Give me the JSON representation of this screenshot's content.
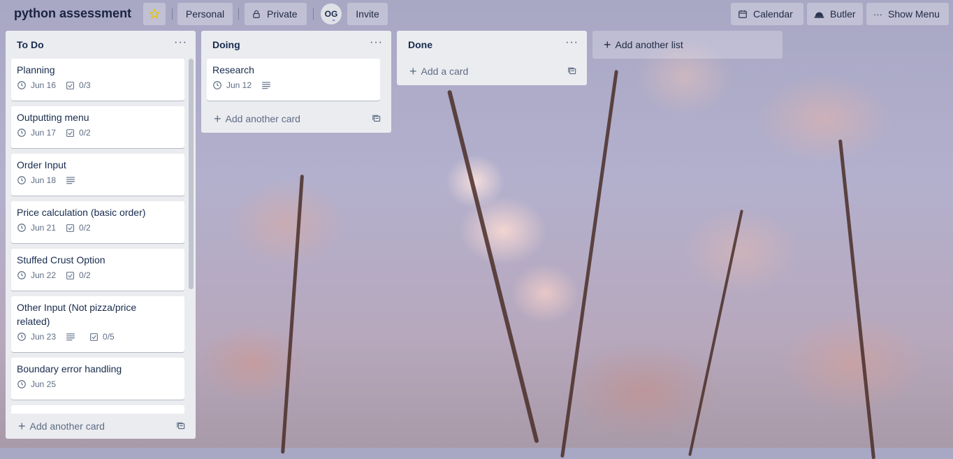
{
  "board": {
    "title": "python assessment",
    "star_icon": "star-icon",
    "visibility_team": "Personal",
    "visibility_privacy": "Private",
    "member_initials": "OG",
    "invite_label": "Invite"
  },
  "header_right": {
    "calendar_label": "Calendar",
    "butler_label": "Butler",
    "menu_label": "Show Menu"
  },
  "colors": {
    "star": "#f2d600",
    "list_bg": "#ebecf0",
    "card_bg": "#ffffff"
  },
  "lists": [
    {
      "title": "To Do",
      "cards": [
        {
          "title": "Planning",
          "due": "Jun 16",
          "has_description": false,
          "checklist": "0/3"
        },
        {
          "title": "Outputting menu",
          "due": "Jun 17",
          "has_description": false,
          "checklist": "0/2"
        },
        {
          "title": "Order Input",
          "due": "Jun 18",
          "has_description": true,
          "checklist": ""
        },
        {
          "title": "Price calculation (basic order)",
          "due": "Jun 21",
          "has_description": false,
          "checklist": "0/2"
        },
        {
          "title": "Stuffed Crust Option",
          "due": "Jun 22",
          "has_description": false,
          "checklist": "0/2"
        },
        {
          "title": "Other Input (Not pizza/price related)",
          "due": "Jun 23",
          "has_description": true,
          "checklist": "0/5"
        },
        {
          "title": "Boundary error handling",
          "due": "Jun 25",
          "has_description": false,
          "checklist": ""
        }
      ],
      "add_label": "Add another card"
    },
    {
      "title": "Doing",
      "cards": [
        {
          "title": "Research",
          "due": "Jun 12",
          "has_description": true,
          "checklist": ""
        }
      ],
      "add_label": "Add another card"
    },
    {
      "title": "Done",
      "cards": [],
      "add_label": "Add a card"
    }
  ],
  "add_list_label": "Add another list"
}
